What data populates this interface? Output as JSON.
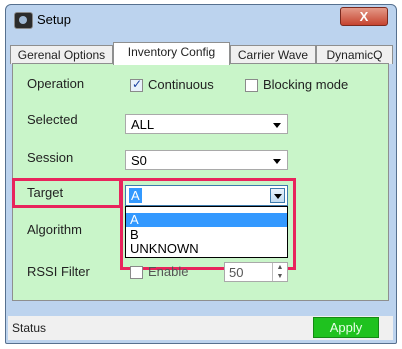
{
  "window": {
    "title": "Setup",
    "close_label": "X",
    "icon": "app-icon"
  },
  "tabs": [
    {
      "label": "Gerenal Options",
      "active": false
    },
    {
      "label": "Inventory Config",
      "active": true
    },
    {
      "label": "Carrier Wave",
      "active": false
    },
    {
      "label": "DynamicQ",
      "active": false
    }
  ],
  "form": {
    "operation": {
      "label": "Operation",
      "continuous_label": "Continuous",
      "continuous_checked": true,
      "blocking_label": "Blocking mode",
      "blocking_checked": false
    },
    "selected": {
      "label": "Selected",
      "value": "ALL"
    },
    "session": {
      "label": "Session",
      "value": "S0"
    },
    "target": {
      "label": "Target",
      "value": "A",
      "options": [
        "A",
        "B",
        "UNKNOWN"
      ],
      "highlighted_option": "A"
    },
    "algorithm": {
      "label": "Algorithm"
    },
    "rssi_filter": {
      "label": "RSSI Filter",
      "enable_label": "Enable",
      "enable_checked": false,
      "value": "50"
    }
  },
  "status": {
    "text": "Status",
    "apply_label": "Apply"
  },
  "colors": {
    "panel_bg": "#c9f5c9",
    "highlight": "#e8245c",
    "apply_bg": "#1fc21f",
    "selection": "#3399ff"
  }
}
